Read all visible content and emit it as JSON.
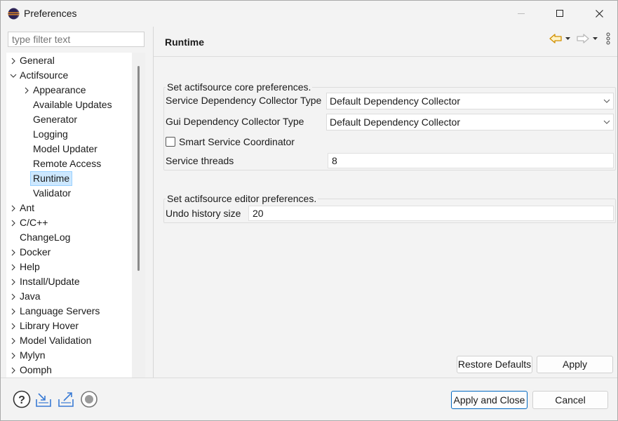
{
  "window": {
    "title": "Preferences",
    "controls": [
      "minimize-icon",
      "maximize-icon",
      "close-icon"
    ]
  },
  "filter": {
    "placeholder": "type filter text"
  },
  "tree": [
    {
      "label": "General",
      "expander": "collapsed",
      "level": 0
    },
    {
      "label": "Actifsource",
      "expander": "expanded",
      "level": 0
    },
    {
      "label": "Appearance",
      "expander": "collapsed",
      "level": 1
    },
    {
      "label": "Available Updates",
      "expander": "none",
      "level": 1
    },
    {
      "label": "Generator",
      "expander": "none",
      "level": 1
    },
    {
      "label": "Logging",
      "expander": "none",
      "level": 1
    },
    {
      "label": "Model Updater",
      "expander": "none",
      "level": 1
    },
    {
      "label": "Remote Access",
      "expander": "none",
      "level": 1
    },
    {
      "label": "Runtime",
      "expander": "none",
      "level": 1,
      "selected": true
    },
    {
      "label": "Validator",
      "expander": "none",
      "level": 1
    },
    {
      "label": "Ant",
      "expander": "collapsed",
      "level": 0
    },
    {
      "label": "C/C++",
      "expander": "collapsed",
      "level": 0
    },
    {
      "label": "ChangeLog",
      "expander": "none",
      "level": 0
    },
    {
      "label": "Docker",
      "expander": "collapsed",
      "level": 0
    },
    {
      "label": "Help",
      "expander": "collapsed",
      "level": 0
    },
    {
      "label": "Install/Update",
      "expander": "collapsed",
      "level": 0
    },
    {
      "label": "Java",
      "expander": "collapsed",
      "level": 0
    },
    {
      "label": "Language Servers",
      "expander": "collapsed",
      "level": 0
    },
    {
      "label": "Library Hover",
      "expander": "collapsed",
      "level": 0
    },
    {
      "label": "Model Validation",
      "expander": "collapsed",
      "level": 0
    },
    {
      "label": "Mylyn",
      "expander": "collapsed",
      "level": 0
    },
    {
      "label": "Oomph",
      "expander": "collapsed",
      "level": 0
    }
  ],
  "page": {
    "title": "Runtime",
    "nav_icons": [
      "back-arrow-icon",
      "dropdown-icon",
      "forward-arrow-icon",
      "dropdown-icon",
      "view-menu-icon"
    ],
    "core_group": {
      "title": "Set actifsource core preferences.",
      "service_dep_label": "Service Dependency Collector Type",
      "service_dep_value": "Default Dependency Collector",
      "gui_dep_label": "Gui Dependency Collector Type",
      "gui_dep_value": "Default Dependency Collector",
      "smart_label": "Smart Service Coordinator",
      "smart_checked": false,
      "threads_label": "Service threads",
      "threads_value": "8"
    },
    "editor_group": {
      "title": "Set actifsource editor preferences.",
      "undo_label": "Undo history size",
      "undo_value": "20"
    },
    "restore_label": "Restore Defaults",
    "apply_label": "Apply"
  },
  "footer": {
    "icons": [
      "help-icon",
      "import-icon",
      "export-icon",
      "record-icon"
    ],
    "apply_close_label": "Apply and Close",
    "cancel_label": "Cancel"
  },
  "colors": {
    "selection_bg": "#cde8ff",
    "selection_border": "#99d1ff",
    "accent": "#0067c0",
    "nav_arrow": "#e8a317"
  }
}
